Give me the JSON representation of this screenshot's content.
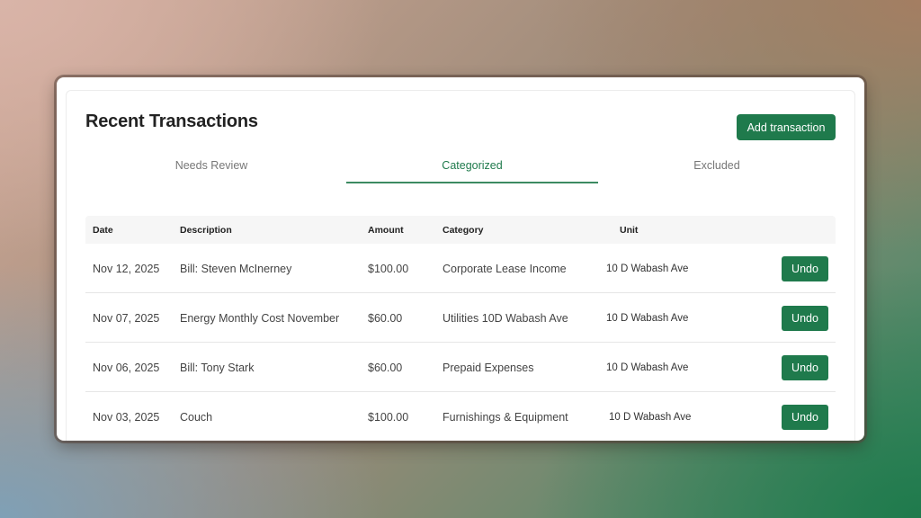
{
  "header": {
    "title": "Recent Transactions",
    "add_button": "Add transaction"
  },
  "tabs": [
    {
      "label": "Needs Review",
      "active": false
    },
    {
      "label": "Categorized",
      "active": true
    },
    {
      "label": "Excluded",
      "active": false
    }
  ],
  "table": {
    "columns": [
      "Date",
      "Description",
      "Amount",
      "Category",
      "Unit"
    ],
    "rows": [
      {
        "date": "Nov 12, 2025",
        "description": "Bill: Steven McInerney",
        "amount": "$100.00",
        "category": "Corporate Lease Income",
        "unit": "10 D Wabash Ave",
        "action": "Undo"
      },
      {
        "date": "Nov 07, 2025",
        "description": "Energy Monthly Cost November",
        "amount": "$60.00",
        "category": "Utilities 10D Wabash Ave",
        "unit": "10 D Wabash Ave",
        "action": "Undo"
      },
      {
        "date": "Nov 06, 2025",
        "description": "Bill: Tony Stark",
        "amount": "$60.00",
        "category": "Prepaid Expenses",
        "unit": "10 D Wabash Ave",
        "action": "Undo"
      },
      {
        "date": "Nov 03, 2025",
        "description": "Couch",
        "amount": "$100.00",
        "category": "Furnishings & Equipment",
        "unit": "10 D Wabash Ave",
        "action": "Undo"
      }
    ]
  },
  "colors": {
    "accent": "#1f7a4c"
  }
}
